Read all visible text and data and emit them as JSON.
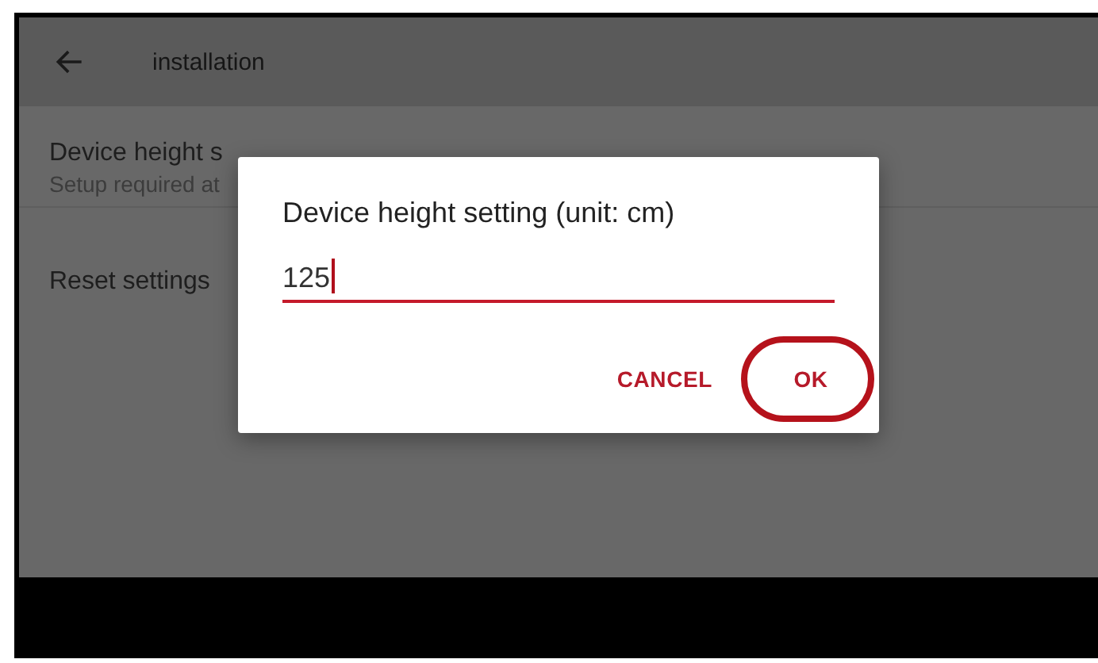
{
  "toolbar": {
    "title": "installation"
  },
  "settings": [
    {
      "title": "Device height s",
      "subtitle": "Setup required at"
    },
    {
      "title": "Reset settings"
    }
  ],
  "dialog": {
    "title": "Device height setting (unit: cm)",
    "field": {
      "value": "125",
      "focused": true
    },
    "buttons": [
      {
        "label": "CANCEL",
        "highlighted": false
      },
      {
        "label": "OK",
        "highlighted": true
      }
    ]
  }
}
